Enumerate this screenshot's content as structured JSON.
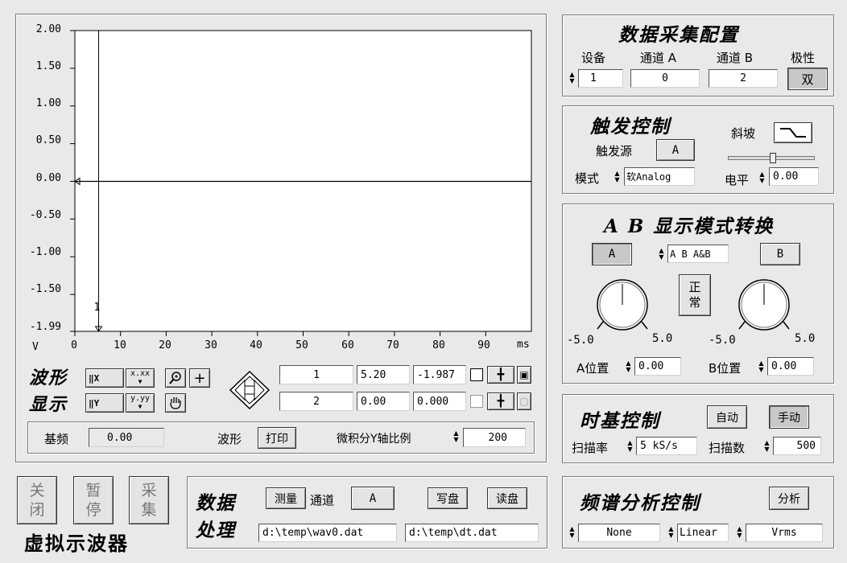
{
  "app": {
    "title": "虚拟示波器"
  },
  "chart_data": {
    "type": "line",
    "x_unit": "ms",
    "y_unit": "V",
    "xlim": [
      0,
      100
    ],
    "ylim": [
      -1.99,
      2.0
    ],
    "x_ticks": [
      "0",
      "10",
      "20",
      "30",
      "40",
      "50",
      "60",
      "70",
      "80",
      "90"
    ],
    "y_ticks": [
      "2.00",
      "1.50",
      "1.00",
      "0.50",
      "0.00",
      "-0.50",
      "-1.00",
      "-1.50",
      "-1.99"
    ],
    "series": [
      {
        "x": [
          0,
          100
        ],
        "y": [
          0.0,
          0.0
        ]
      }
    ],
    "cursors": [
      {
        "label": "1",
        "x": 5.2
      }
    ]
  },
  "waveform": {
    "title_line1": "波形",
    "title_line2": "显示",
    "fmt_x": "x.xx",
    "fmt_y": "y.yy",
    "cursor_rows": [
      {
        "id": "1",
        "x": "5.20",
        "y": "-1.987"
      },
      {
        "id": "2",
        "x": "0.00",
        "y": "0.000"
      }
    ]
  },
  "bottom_bar": {
    "base_freq_label": "基频",
    "base_freq_value": "0.00",
    "waveform_label": "波形",
    "print_label": "打印",
    "scale_label": "微积分Y轴比例",
    "scale_value": "200"
  },
  "acq": {
    "title": "数据采集配置",
    "device_label": "设备",
    "chan_a_label": "通道 A",
    "chan_b_label": "通道 B",
    "polarity_label": "极性",
    "device_value": "1",
    "chan_a_value": "0",
    "chan_b_value": "2",
    "polarity_value": "双"
  },
  "trigger": {
    "title": "触发控制",
    "source_label": "触发源",
    "source_value": "A",
    "slope_label": "斜坡",
    "mode_label": "模式",
    "mode_value": "软Analog",
    "level_label": "电平",
    "level_value": "0.00"
  },
  "ab": {
    "title": "A B 显示模式转换",
    "a_label": "A",
    "b_label": "B",
    "mode_value": "A B A&B",
    "normal_line1": "正",
    "normal_line2": "常",
    "a_min": "-5.0",
    "a_max": "5.0",
    "b_min": "-5.0",
    "b_max": "5.0",
    "a_pos_label": "A位置",
    "a_pos_value": "0.00",
    "b_pos_label": "B位置",
    "b_pos_value": "0.00"
  },
  "timebase": {
    "title": "时基控制",
    "auto_label": "自动",
    "manual_label": "手动",
    "rate_label": "扫描率",
    "rate_value": "5 kS/s",
    "count_label": "扫描数",
    "count_value": "500"
  },
  "controls": {
    "close_1": "关",
    "close_2": "闭",
    "pause_1": "暂",
    "pause_2": "停",
    "collect_1": "采",
    "collect_2": "集"
  },
  "data_proc": {
    "title_line1": "数据",
    "title_line2": "处理",
    "measure_label": "测量",
    "channel_label": "通道",
    "channel_value": "A",
    "write_label": "写盘",
    "read_label": "读盘",
    "file1": "d:\\temp\\wav0.dat",
    "file2": "d:\\temp\\dt.dat"
  },
  "spectrum": {
    "title": "频谱分析控制",
    "analyze_label": "分析",
    "window_value": "None",
    "scale_value": "Linear",
    "unit_value": "Vrms"
  }
}
